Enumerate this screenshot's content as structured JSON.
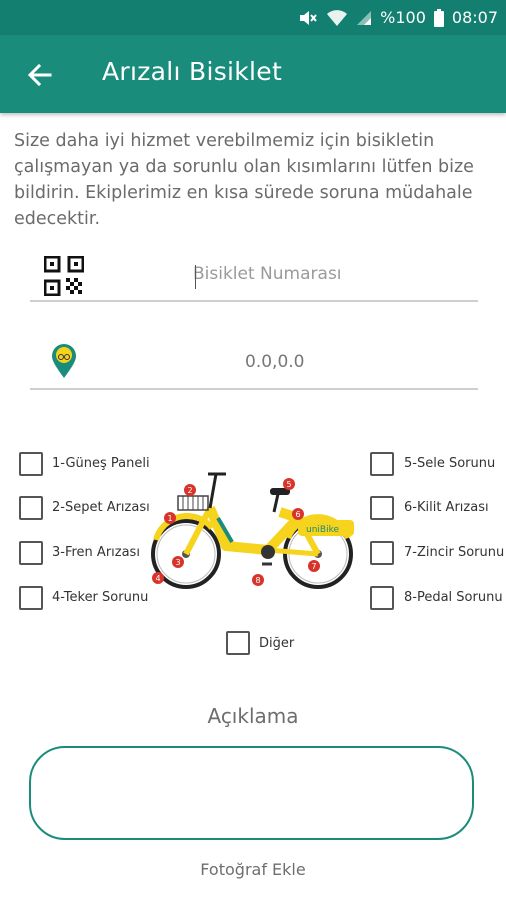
{
  "status_bar": {
    "battery": "%100",
    "time": "08:07",
    "icons": [
      "mute-icon",
      "wifi-icon",
      "signal-icon",
      "battery-icon"
    ]
  },
  "app_bar": {
    "title": "Arızalı Bisiklet",
    "back_icon": "arrow-back-icon",
    "bg_color": "#1a8c7b"
  },
  "intro_text": "Size daha iyi hizmet verebilmemiz için bisikletin çalışmayan ya da sorunlu olan kısımlarını lütfen bize bildirin. Ekiplerimiz en kısa sürede soruna müdahale edecektir.",
  "bike_number": {
    "placeholder": "Bisiklet Numarası",
    "value": "",
    "icon": "qr-code-icon"
  },
  "location": {
    "value": "0.0,0.0",
    "icon": "location-pin-icon"
  },
  "problems": {
    "left": [
      {
        "label": "1-Güneş Paneli",
        "checked": false
      },
      {
        "label": "2-Sepet Arızası",
        "checked": false
      },
      {
        "label": "3-Fren Arızası",
        "checked": false
      },
      {
        "label": "4-Teker Sorunu",
        "checked": false
      }
    ],
    "right": [
      {
        "label": "5-Sele Sorunu",
        "checked": false
      },
      {
        "label": "6-Kilit Arızası",
        "checked": false
      },
      {
        "label": "7-Zincir Sorunu",
        "checked": false
      },
      {
        "label": "8-Pedal Sorunu",
        "checked": false
      }
    ],
    "other": {
      "label": "Diğer",
      "checked": false
    }
  },
  "bike_image": {
    "brand": "uniBike",
    "markers": [
      "1",
      "2",
      "3",
      "4",
      "5",
      "6",
      "7",
      "8"
    ],
    "frame_color": "#f6d31c",
    "marker_color": "#d9342b"
  },
  "description": {
    "title": "Açıklama",
    "value": ""
  },
  "add_photo_label": "Fotoğraf Ekle"
}
